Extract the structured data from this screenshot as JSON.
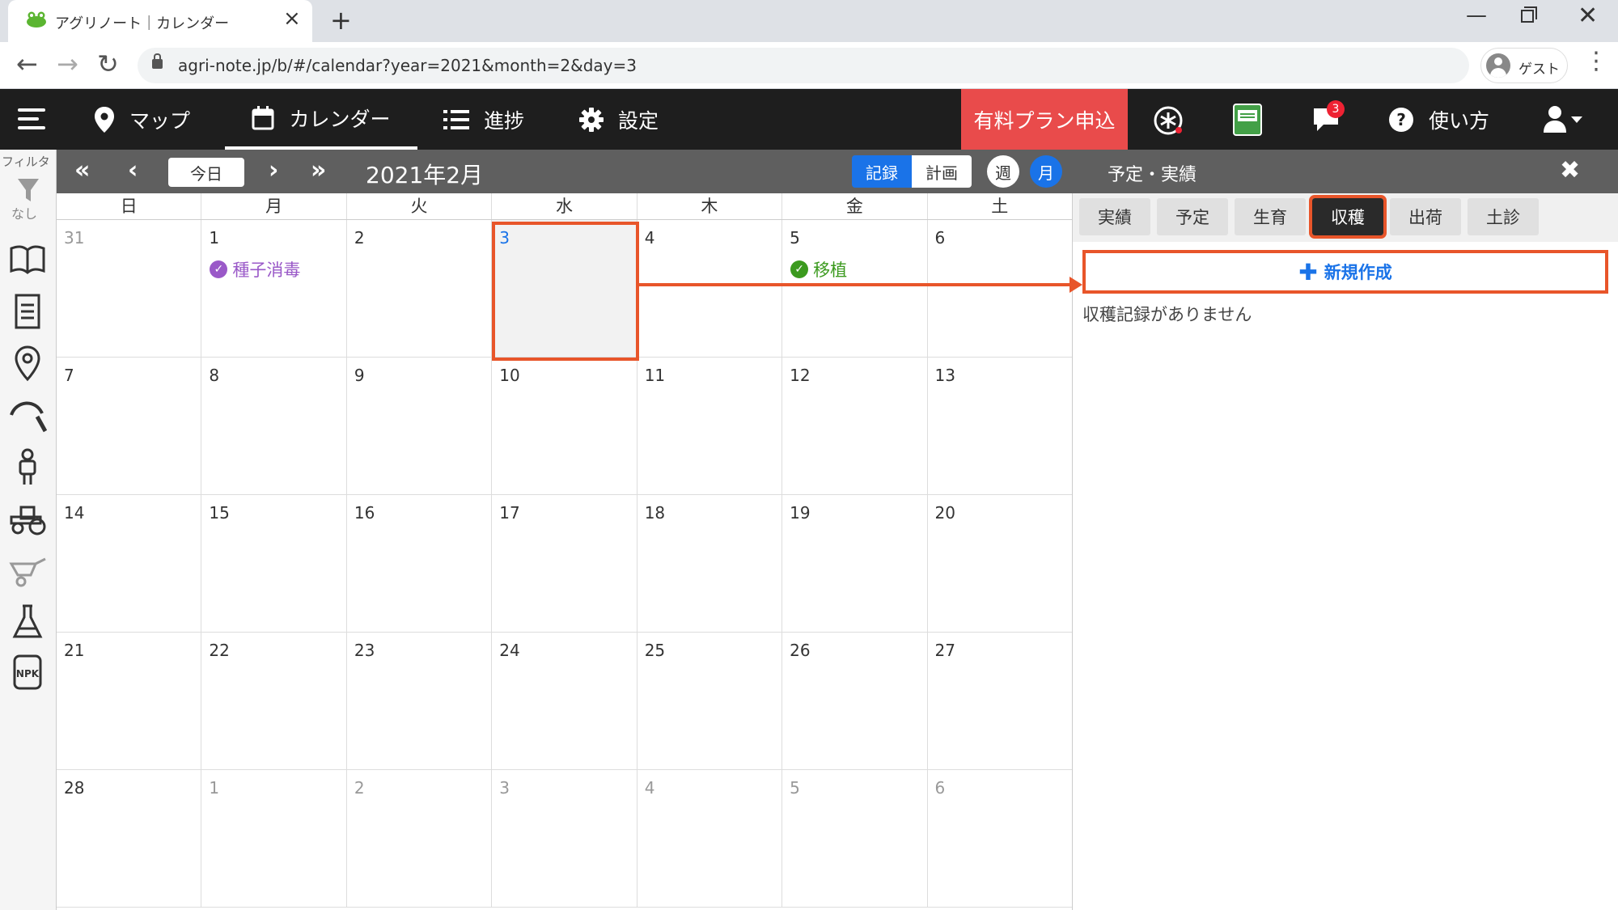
{
  "browser": {
    "tab_title": "アグリノート｜カレンダー",
    "url": "agri-note.jp/b/#/calendar?year=2021&month=2&day=3",
    "profile_label": "ゲスト"
  },
  "header": {
    "nav": [
      {
        "label": "マップ",
        "icon": "map-pin-icon"
      },
      {
        "label": "カレンダー",
        "icon": "calendar-icon"
      },
      {
        "label": "進捗",
        "icon": "checklist-icon"
      },
      {
        "label": "設定",
        "icon": "gear-icon"
      }
    ],
    "paid_plan": "有料プラン申込",
    "notification_count": "3"
  },
  "sidebar": {
    "filter_label": "フィルタ",
    "filter_value": "なし",
    "icons": [
      "book-icon",
      "document-icon",
      "location-icon",
      "sickle-icon",
      "worker-icon",
      "tractor-icon",
      "wheelbarrow-icon",
      "flask-icon",
      "npk-fertilizer-icon"
    ],
    "npk_text": "NPK"
  },
  "calendar": {
    "today_label": "今日",
    "month_title": "2021年2月",
    "mode_record": "記録",
    "mode_plan": "計画",
    "view_week": "週",
    "view_month": "月",
    "weekdays": [
      "日",
      "月",
      "火",
      "水",
      "木",
      "金",
      "土"
    ],
    "weeks": [
      [
        {
          "d": "31",
          "other": true
        },
        {
          "d": "1"
        },
        {
          "d": "2"
        },
        {
          "d": "3",
          "today": true
        },
        {
          "d": "4"
        },
        {
          "d": "5"
        },
        {
          "d": "6"
        }
      ],
      [
        {
          "d": "7"
        },
        {
          "d": "8"
        },
        {
          "d": "9"
        },
        {
          "d": "10"
        },
        {
          "d": "11"
        },
        {
          "d": "12"
        },
        {
          "d": "13"
        }
      ],
      [
        {
          "d": "14"
        },
        {
          "d": "15"
        },
        {
          "d": "16"
        },
        {
          "d": "17"
        },
        {
          "d": "18"
        },
        {
          "d": "19"
        },
        {
          "d": "20"
        }
      ],
      [
        {
          "d": "21"
        },
        {
          "d": "22"
        },
        {
          "d": "23"
        },
        {
          "d": "24"
        },
        {
          "d": "25"
        },
        {
          "d": "26"
        },
        {
          "d": "27"
        }
      ],
      [
        {
          "d": "28"
        },
        {
          "d": "1",
          "other": true
        },
        {
          "d": "2",
          "other": true
        },
        {
          "d": "3",
          "other": true
        },
        {
          "d": "4",
          "other": true
        },
        {
          "d": "5",
          "other": true
        },
        {
          "d": "6",
          "other": true
        }
      ]
    ],
    "events": [
      {
        "week": 0,
        "day": 1,
        "label": "種子消毒",
        "color": "purple"
      },
      {
        "week": 0,
        "day": 5,
        "label": "移植",
        "color": "green"
      }
    ]
  },
  "panel": {
    "title": "予定・実績",
    "tabs": [
      "実績",
      "予定",
      "生育",
      "収穫",
      "出荷",
      "土診"
    ],
    "active_tab": 3,
    "new_button": "新規作成",
    "empty_message": "収穫記録がありません"
  },
  "colors": {
    "accent_blue": "#1a73e8",
    "highlight_orange": "#e8552a",
    "paid_red": "#e94b4b",
    "event_purple": "#9a59c8",
    "event_green": "#3b9a1e"
  }
}
